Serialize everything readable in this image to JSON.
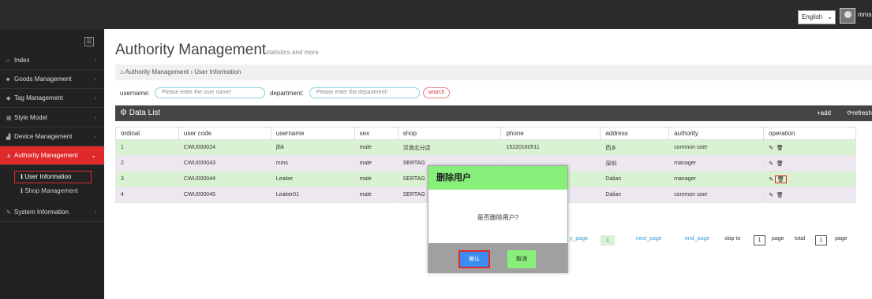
{
  "topbar": {
    "language": "English",
    "user": "mms"
  },
  "sidebar": {
    "items": [
      {
        "label": "Index",
        "icon": "home-icon"
      },
      {
        "label": "Goods Management",
        "icon": "folder-icon"
      },
      {
        "label": "Tag Management",
        "icon": "tag-icon"
      },
      {
        "label": "Style Model",
        "icon": "grid-icon"
      },
      {
        "label": "Device Management",
        "icon": "bar-chart-icon"
      },
      {
        "label": "Authority Management",
        "icon": "user-icon"
      },
      {
        "label": "System Information",
        "icon": "edit-icon"
      }
    ],
    "sub_items": [
      "User Information",
      "Shop Management"
    ]
  },
  "page": {
    "title": "Authority Management",
    "subtitle": "statistics and more",
    "breadcrumb": [
      "Authority Management",
      "User Information"
    ]
  },
  "filters": {
    "username_label": "username:",
    "username_placeholder": "Please enter the user name!",
    "department_label": "department:",
    "department_placeholder": "Please enter the department!",
    "search_label": "search"
  },
  "datalist": {
    "title": "Data List",
    "add_label": "add",
    "refresh_label": "refresh"
  },
  "table": {
    "columns": [
      "ordinal",
      "user code",
      "username",
      "sex",
      "shop",
      "phone",
      "address",
      "authority",
      "operation"
    ],
    "rows": [
      {
        "ordinal": "1",
        "code": "CWU000024",
        "username": "jlbk",
        "sex": "male",
        "shop": "洪浪北分店",
        "phone": "15220180511",
        "address": "西乡",
        "authority": "common user"
      },
      {
        "ordinal": "2",
        "code": "CWU000043",
        "username": "mms",
        "sex": "male",
        "shop": "SERTAG",
        "phone": "",
        "address": "深圳",
        "authority": "manager"
      },
      {
        "ordinal": "3",
        "code": "CWU000044",
        "username": "Leaker",
        "sex": "male",
        "shop": "SERTAG",
        "phone": "",
        "address": "Dalian",
        "authority": "manager"
      },
      {
        "ordinal": "4",
        "code": "CWU000045",
        "username": "Leaker01",
        "sex": "male",
        "shop": "SERTAG",
        "phone": "",
        "address": "Dalian",
        "authority": "common user"
      }
    ]
  },
  "pagination": {
    "prev_label": "y_page",
    "current": "1",
    "next_label": "next_page",
    "end_label": "end_page",
    "skip_label": "skip to",
    "skip_value": "1",
    "page_label": "page",
    "total_label": "total",
    "total_value": "1",
    "page_label2": "page"
  },
  "modal": {
    "title": "删除用户",
    "message": "是否删除用户?",
    "confirm": "确认",
    "cancel": "取消"
  },
  "colors": {
    "accent": "#e02a2a",
    "green_row": "#d9f2d2",
    "modal_header": "#88f07a",
    "confirm_button": "#3b8cf0"
  }
}
